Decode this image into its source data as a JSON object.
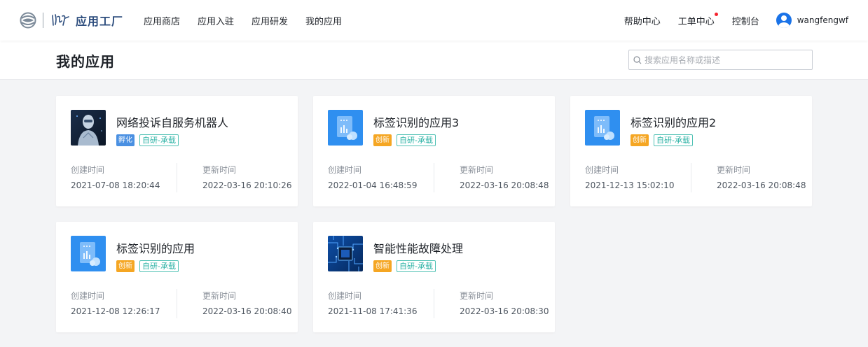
{
  "brand": {
    "name": "应用工厂"
  },
  "nav": [
    "应用商店",
    "应用入驻",
    "应用研发",
    "我的应用"
  ],
  "nav_right": {
    "help": "帮助中心",
    "tickets": "工单中心",
    "console": "控制台",
    "username": "wangfengwf"
  },
  "page": {
    "title": "我的应用"
  },
  "search": {
    "placeholder": "搜索应用名称或描述"
  },
  "labels": {
    "created": "创建时间",
    "updated": "更新时间"
  },
  "colors": {
    "accent": "#1a73e8",
    "tag_incubate": "#4a90e2",
    "tag_innovate": "#f5a623",
    "tag_type": "#2eb3a6"
  },
  "cards": [
    {
      "name": "网络投诉自服务机器人",
      "status": "孵化",
      "status_color": "#4a90e2",
      "type": "自研-承载",
      "created": "2021-07-08 18:20:44",
      "updated": "2022-03-16 20:10:26",
      "icon": "robot-image-icon"
    },
    {
      "name": "标签识别的应用3",
      "status": "创新",
      "status_color": "#f5a623",
      "type": "自研-承载",
      "created": "2022-01-04 16:48:59",
      "updated": "2022-03-16 20:08:48",
      "icon": "app-document-icon"
    },
    {
      "name": "标签识别的应用2",
      "status": "创新",
      "status_color": "#f5a623",
      "type": "自研-承载",
      "created": "2021-12-13 15:02:10",
      "updated": "2022-03-16 20:08:48",
      "icon": "app-document-icon"
    },
    {
      "name": "标签识别的应用",
      "status": "创新",
      "status_color": "#f5a623",
      "type": "自研-承载",
      "created": "2021-12-08 12:26:17",
      "updated": "2022-03-16 20:08:40",
      "icon": "app-document-icon"
    },
    {
      "name": "智能性能故障处理",
      "status": "创新",
      "status_color": "#f5a623",
      "type": "自研-承载",
      "created": "2021-11-08 17:41:36",
      "updated": "2022-03-16 20:08:30",
      "icon": "circuit-chip-image-icon"
    }
  ]
}
